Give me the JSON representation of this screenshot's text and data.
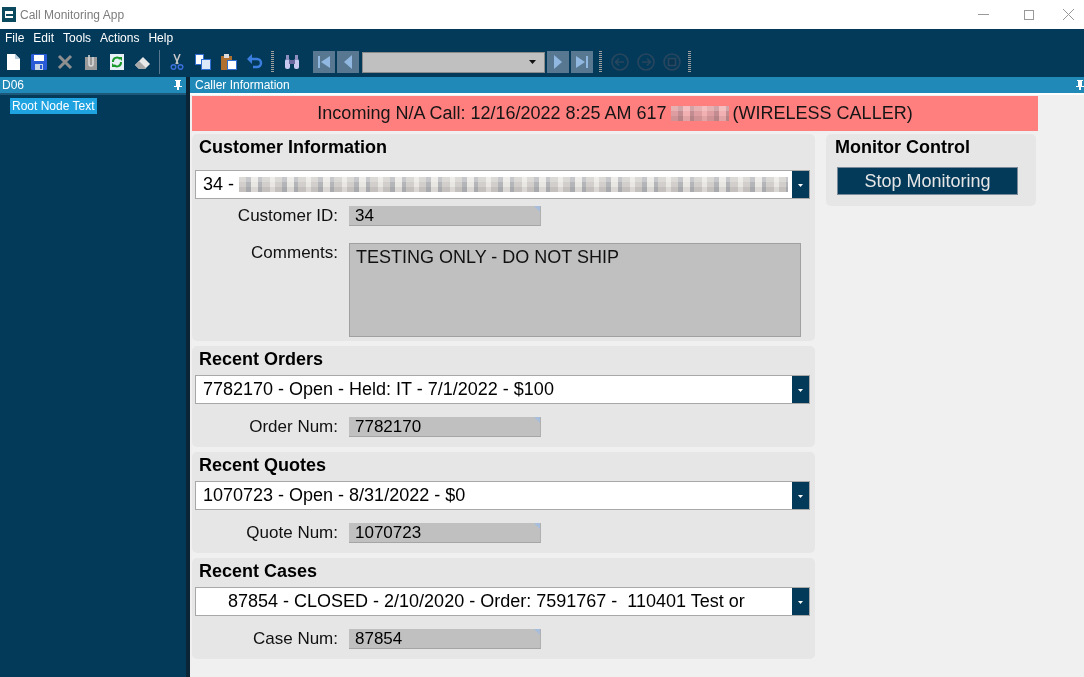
{
  "window": {
    "title": "Call Monitoring App"
  },
  "menu_bar": [
    {
      "label": "File"
    },
    {
      "label": "Edit"
    },
    {
      "label": "Tools"
    },
    {
      "label": "Actions"
    },
    {
      "label": "Help"
    }
  ],
  "toolbar": {
    "history_buttons": [
      {
        "disabled": true
      },
      {
        "disabled": true
      },
      {
        "disabled": true
      }
    ]
  },
  "left_panel": {
    "title": "D06",
    "tree": [
      {
        "label": "Root Node Text",
        "selected": true
      }
    ]
  },
  "main_panel": {
    "title": "Caller Information",
    "banner": {
      "text": "Incoming N/A Call: 12/16/2022 8:25 AM 617",
      "redacted": true,
      "suffix": "(WIRELESS CALLER)"
    },
    "sections": [
      {
        "kind": "customer",
        "title": "Customer Information",
        "select": {
          "value": "34 -",
          "redacted": true
        },
        "fields": [
          {
            "kind": "line",
            "label": "Customer ID:",
            "value": "34"
          },
          {
            "kind": "area",
            "label": "Comments:",
            "value": "TESTING ONLY - DO NOT SHIP"
          }
        ]
      },
      {
        "kind": "record",
        "title": "Recent Orders",
        "select": {
          "value": "7782170 - Open - Held: IT - 7/1/2022 - $100",
          "redacted": false
        },
        "fields": [
          {
            "kind": "line",
            "label": "Order Num:",
            "value": "7782170"
          }
        ]
      },
      {
        "kind": "record",
        "title": "Recent Quotes",
        "select": {
          "value": "1070723 - Open - 8/31/2022 - $0",
          "redacted": false
        },
        "fields": [
          {
            "kind": "line",
            "label": "Quote Num:",
            "value": "1070723"
          }
        ]
      },
      {
        "kind": "record",
        "title": "Recent Cases",
        "select": {
          "value": "     87854 - CLOSED - 2/10/2020 - Order: 7591767 -  110401 Test or",
          "redacted": false
        },
        "fields": [
          {
            "kind": "line",
            "label": "Case Num:",
            "value": "87854"
          }
        ]
      }
    ],
    "monitor_control": {
      "title": "Monitor Control",
      "button": "Stop Monitoring"
    }
  }
}
